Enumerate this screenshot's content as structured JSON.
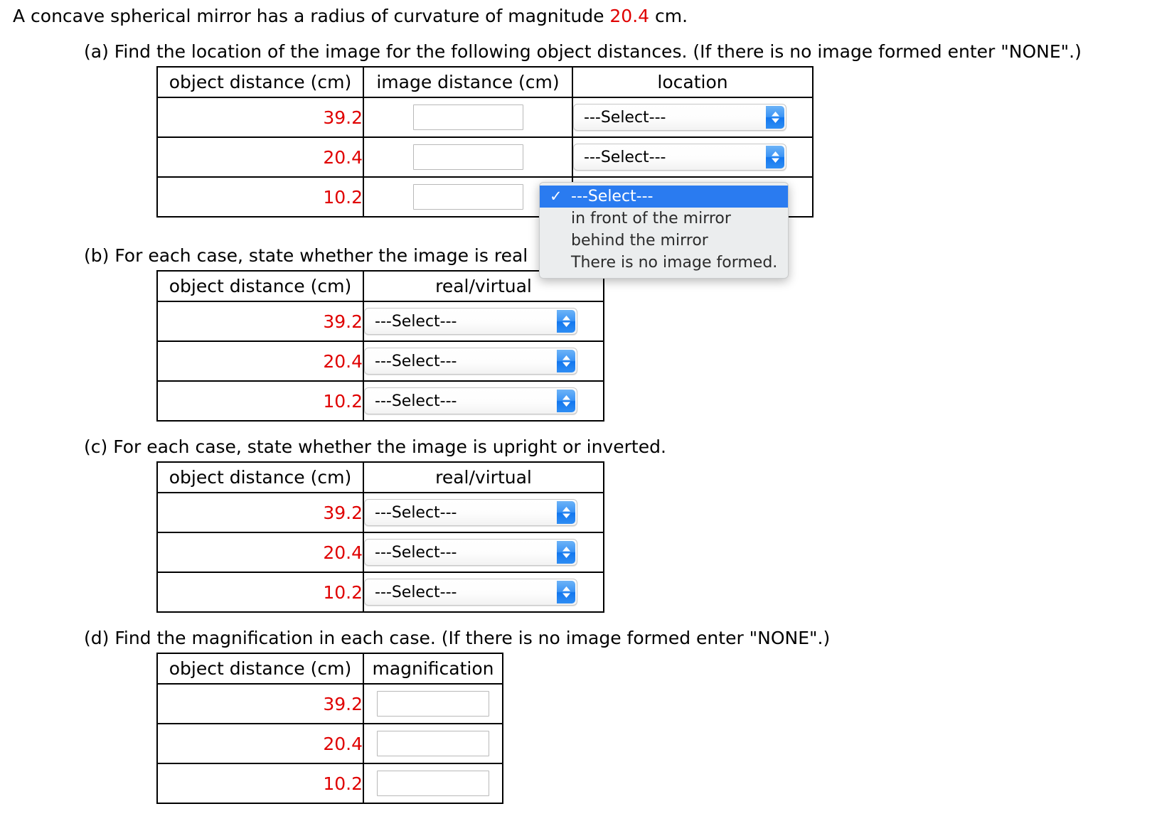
{
  "problem": {
    "stem_prefix": "A concave spherical mirror has a radius of curvature of magnitude ",
    "stem_value": "20.4",
    "stem_suffix": " cm."
  },
  "parts": {
    "a": {
      "label": "(a) Find the location of the image for the following object distances. (If there is no image formed enter \"NONE\".)",
      "headers": [
        "object distance (cm)",
        "image distance (cm)",
        "location"
      ],
      "rows": [
        {
          "object_distance": "39.2",
          "image_distance": "",
          "location": "---Select---"
        },
        {
          "object_distance": "20.4",
          "image_distance": "",
          "location": "---Select---"
        },
        {
          "object_distance": "10.2",
          "image_distance": "",
          "location": "---Select---"
        }
      ]
    },
    "b": {
      "label": "(b) For each case, state whether the image is real",
      "headers": [
        "object distance (cm)",
        "real/virtual"
      ],
      "rows": [
        {
          "object_distance": "39.2",
          "value": "---Select---"
        },
        {
          "object_distance": "20.4",
          "value": "---Select---"
        },
        {
          "object_distance": "10.2",
          "value": "---Select---"
        }
      ]
    },
    "c": {
      "label": "(c) For each case, state whether the image is upright or inverted.",
      "headers": [
        "object distance (cm)",
        "real/virtual"
      ],
      "rows": [
        {
          "object_distance": "39.2",
          "value": "---Select---"
        },
        {
          "object_distance": "20.4",
          "value": "---Select---"
        },
        {
          "object_distance": "10.2",
          "value": "---Select---"
        }
      ]
    },
    "d": {
      "label": "(d) Find the magnification in each case. (If there is no image formed enter \"NONE\".)",
      "headers": [
        "object distance (cm)",
        "magnification"
      ],
      "rows": [
        {
          "object_distance": "39.2",
          "magnification": ""
        },
        {
          "object_distance": "20.4",
          "magnification": ""
        },
        {
          "object_distance": "10.2",
          "magnification": ""
        }
      ]
    }
  },
  "dropdown": {
    "open": true,
    "options": [
      "---Select---",
      "in front of the mirror",
      "behind the mirror",
      "There is no image formed."
    ],
    "selected_index": 0,
    "checkmark": "✓",
    "highlight_color": "#2a7bf0",
    "background_color": "#ebedee"
  },
  "colors": {
    "value_red": "#e00000",
    "select_arrow_blue": "#2a7bf0"
  }
}
